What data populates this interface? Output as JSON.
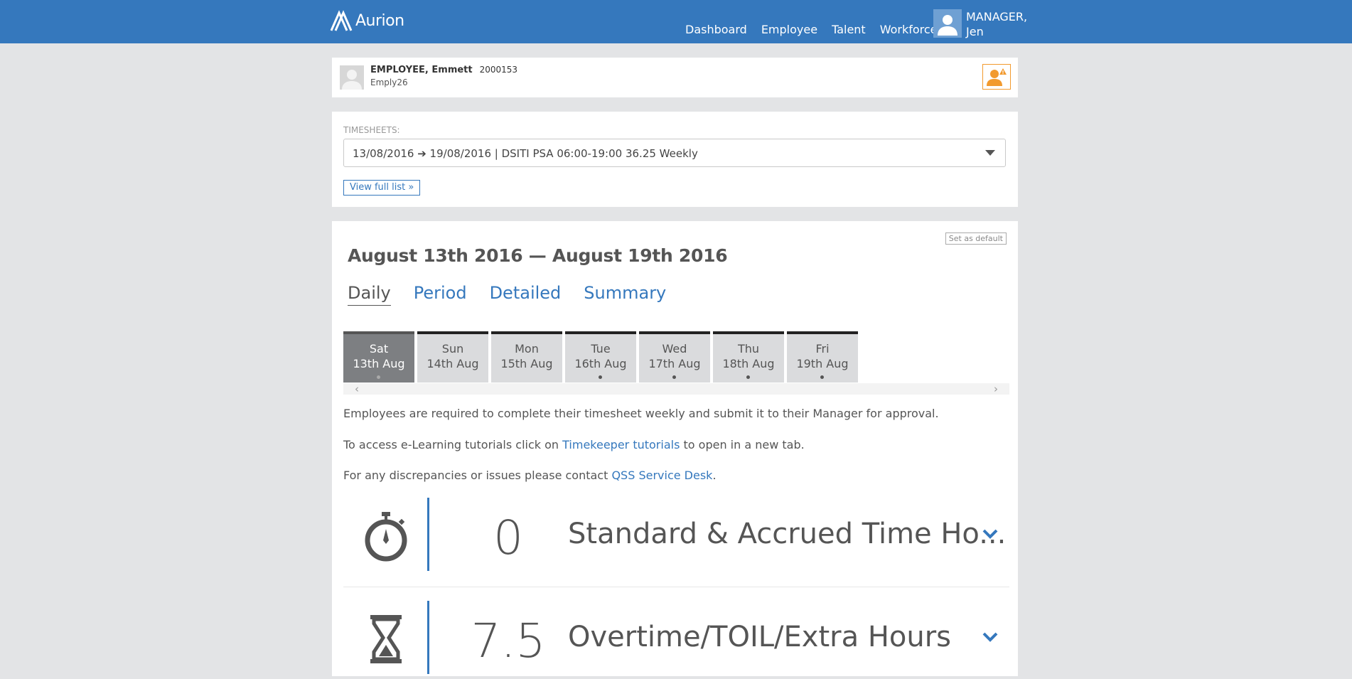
{
  "brand": {
    "name": "Aurion",
    "color": "#3578bd"
  },
  "nav": {
    "items": [
      "Dashboard",
      "Employee",
      "Talent",
      "Workforce"
    ],
    "user_line1": "MANAGER,",
    "user_line2": "Jen"
  },
  "employee": {
    "name": "EMPLOYEE, Emmett",
    "id": "2000153",
    "username": "Emply26"
  },
  "timesheets": {
    "label": "TIMESHEETS:",
    "selected": "13/08/2016 ➔ 19/08/2016 | DSITI PSA 06:00-19:00 36.25 Weekly",
    "view_full": "View full list »"
  },
  "main": {
    "set_default": "Set as default",
    "title": "August 13th 2016 — August 19th 2016",
    "tabs": [
      "Daily",
      "Period",
      "Detailed",
      "Summary"
    ],
    "active_tab": "Daily",
    "days": [
      {
        "name": "Sat",
        "date": "13th Aug",
        "active": true
      },
      {
        "name": "Sun",
        "date": "14th Aug",
        "active": false
      },
      {
        "name": "Mon",
        "date": "15th Aug",
        "active": false
      },
      {
        "name": "Tue",
        "date": "16th Aug",
        "active": false
      },
      {
        "name": "Wed",
        "date": "17th Aug",
        "active": false
      },
      {
        "name": "Thu",
        "date": "18th Aug",
        "active": false
      },
      {
        "name": "Fri",
        "date": "19th Aug",
        "active": false
      }
    ],
    "info": {
      "line1": "Employees are required to complete their timesheet weekly and submit it to their Manager for approval.",
      "line2_pre": "To access e-Learning tutorials click on ",
      "line2_link": "Timekeeper tutorials",
      "line2_post": " to open in a new tab.",
      "line3_pre": "For any discrepancies or issues please contact ",
      "line3_link": "QSS Service Desk",
      "line3_post": "."
    },
    "metrics": [
      {
        "icon": "stopwatch-icon",
        "value": "0",
        "label": "Standard & Accrued Time Ho..."
      },
      {
        "icon": "hourglass-icon",
        "value": "7.5",
        "label": "Overtime/TOIL/Extra Hours"
      }
    ]
  },
  "colors": {
    "accent": "#3578bd",
    "alert": "#f29a2e",
    "page_bg": "#e3e4e6"
  }
}
